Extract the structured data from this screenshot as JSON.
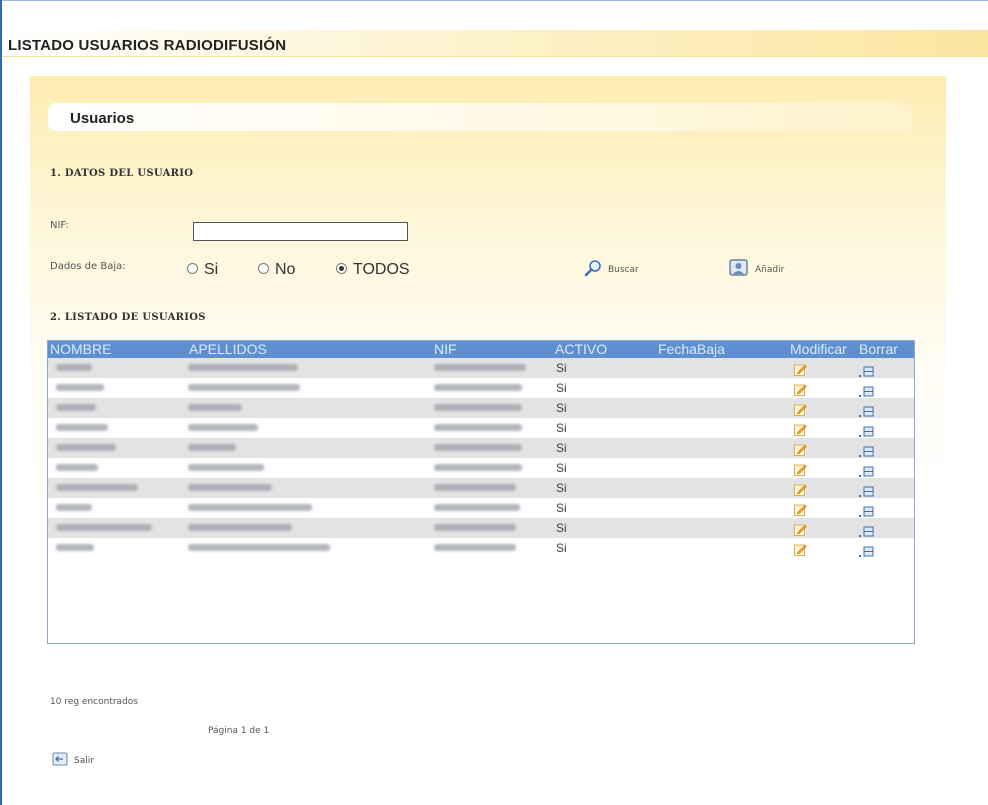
{
  "page": {
    "title": "LISTADO USUARIOS RADIODIFUSIÓN"
  },
  "panel": {
    "header": "Usuarios",
    "section1": "1. DATOS DEL USUARIO",
    "section2": "2. LISTADO DE USUARIOS"
  },
  "form": {
    "nif_label": "NIF:",
    "nif_value": "",
    "baja_label": "Dados de Baja:",
    "radios": [
      {
        "label": "Si",
        "checked": false
      },
      {
        "label": "No",
        "checked": false
      },
      {
        "label": "TODOS",
        "checked": true
      }
    ],
    "buscar_label": "Buscar",
    "anadir_label": "Añadir"
  },
  "table": {
    "headers": [
      "NOMBRE",
      "APELLIDOS",
      "NIF",
      "ACTIVO",
      "FechaBaja",
      "Modificar",
      "Borrar"
    ],
    "rows": [
      {
        "activo": "Si",
        "fecha_baja": ""
      },
      {
        "activo": "Si",
        "fecha_baja": ""
      },
      {
        "activo": "Si",
        "fecha_baja": ""
      },
      {
        "activo": "Si",
        "fecha_baja": ""
      },
      {
        "activo": "Si",
        "fecha_baja": ""
      },
      {
        "activo": "Si",
        "fecha_baja": ""
      },
      {
        "activo": "Si",
        "fecha_baja": ""
      },
      {
        "activo": "Si",
        "fecha_baja": ""
      },
      {
        "activo": "Si",
        "fecha_baja": ""
      },
      {
        "activo": "Si",
        "fecha_baja": ""
      }
    ]
  },
  "footer": {
    "count": "10 reg encontrados",
    "pagination": "Página 1 de 1",
    "salir_label": "Salir"
  },
  "colors": {
    "table_header": "#5e8fd0",
    "row_alt": "#e3e3e3",
    "panel_gradient_top": "#fdecb0"
  },
  "icons": {
    "buscar": "magnifier-icon",
    "anadir": "add-user-icon",
    "modificar": "pencil-edit-icon",
    "borrar": "delete-icon",
    "salir": "exit-icon"
  }
}
